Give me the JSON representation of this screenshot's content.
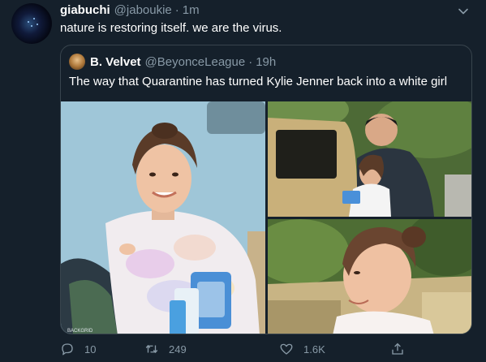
{
  "tweet": {
    "display_name": "giabuchi",
    "handle": "@jaboukie",
    "separator": "·",
    "time": "1m",
    "text": "nature is restoring itself. we are the virus.",
    "more_icon": "chevron-down-icon"
  },
  "quoted_tweet": {
    "display_name": "B. Velvet",
    "handle": "@BeyonceLeague",
    "separator": "·",
    "time": "19h",
    "text": "The way that Quarantine has turned Kylie Jenner back into a white girl",
    "media_count": 3,
    "photo_1_caption": "BACKGRID"
  },
  "actions": {
    "reply_count": "10",
    "retweet_count": "249",
    "like_count": "1.6K",
    "reply_icon": "reply-icon",
    "retweet_icon": "retweet-icon",
    "like_icon": "heart-icon",
    "share_icon": "share-icon"
  },
  "colors": {
    "background": "#15202b",
    "secondary_text": "#8899a6",
    "border": "#38444d"
  }
}
